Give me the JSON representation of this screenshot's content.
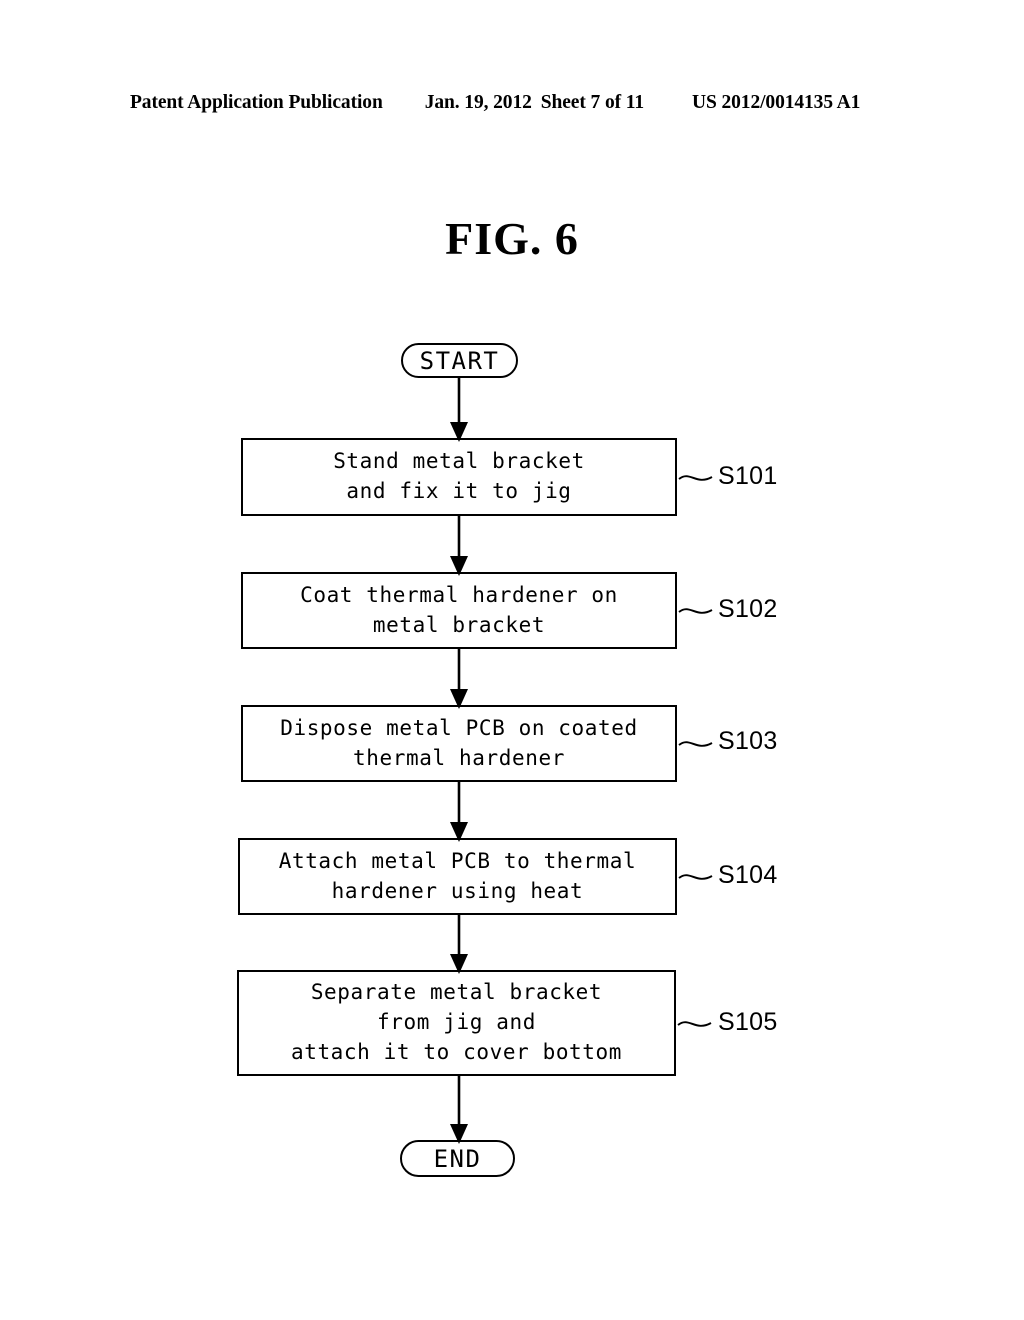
{
  "header": {
    "publication": "Patent Application Publication",
    "date": "Jan. 19, 2012",
    "sheet": "Sheet 7 of 11",
    "publication_number": "US 2012/0014135 A1"
  },
  "figure": {
    "title": "FIG. 6"
  },
  "flowchart": {
    "start_label": "START",
    "end_label": "END",
    "steps": [
      {
        "id": "S101",
        "text": "Stand metal bracket\nand fix it to jig",
        "lines": 2
      },
      {
        "id": "S102",
        "text": "Coat thermal hardener on\nmetal bracket",
        "lines": 2
      },
      {
        "id": "S103",
        "text": "Dispose metal PCB on coated\nthermal hardener",
        "lines": 2
      },
      {
        "id": "S104",
        "text": "Attach metal PCB to thermal\nhardener using heat",
        "lines": 2
      },
      {
        "id": "S105",
        "text": "Separate metal bracket\nfrom jig and\nattach it to cover bottom",
        "lines": 3
      }
    ],
    "colors": {
      "ink": "#000000",
      "paper": "#ffffff"
    }
  }
}
